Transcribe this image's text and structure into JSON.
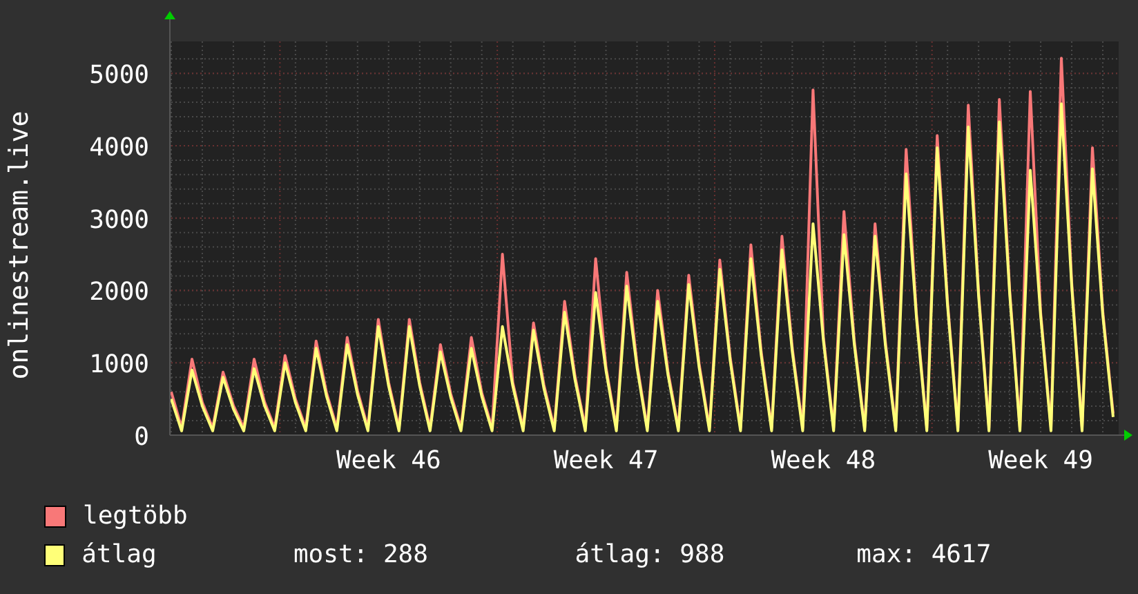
{
  "chart_data": {
    "type": "line",
    "ylabel": "onlinestream.live",
    "grid": true,
    "ylim": [
      0,
      5250
    ],
    "yticks": [
      0,
      1000,
      2000,
      3000,
      4000,
      5000
    ],
    "categories": [
      null,
      null,
      null,
      null,
      null,
      null,
      null,
      null,
      null,
      null,
      null,
      null,
      null,
      null,
      null,
      null,
      null,
      null,
      null,
      null,
      null,
      "Week 46",
      null,
      null,
      null,
      null,
      null,
      null,
      null,
      null,
      null,
      null,
      null,
      null,
      null,
      null,
      null,
      null,
      null,
      null,
      null,
      null,
      "Week 47",
      null,
      null,
      null,
      null,
      null,
      null,
      null,
      null,
      null,
      null,
      null,
      null,
      null,
      null,
      null,
      null,
      null,
      null,
      null,
      null,
      "Week 48",
      null,
      null,
      null,
      null,
      null,
      null,
      null,
      null,
      null,
      null,
      null,
      null,
      null,
      null,
      null,
      null,
      null,
      null,
      null,
      null,
      "Week 49",
      null,
      null,
      null,
      null,
      null,
      null,
      null
    ],
    "series": [
      {
        "name": "legtöbb",
        "color": "#f87878",
        "values": [
          600,
          100,
          1050,
          450,
          100,
          870,
          410,
          100,
          1050,
          460,
          100,
          1100,
          500,
          100,
          1300,
          590,
          100,
          1350,
          610,
          100,
          1600,
          730,
          100,
          1600,
          730,
          100,
          1250,
          570,
          100,
          1350,
          590,
          100,
          2500,
          730,
          100,
          1550,
          700,
          100,
          1850,
          820,
          100,
          2440,
          940,
          100,
          2250,
          980,
          100,
          2000,
          880,
          100,
          2210,
          990,
          100,
          2420,
          1080,
          100,
          2630,
          1150,
          100,
          2750,
          1200,
          100,
          4770,
          1360,
          100,
          3090,
          1300,
          100,
          2920,
          1290,
          100,
          3950,
          1670,
          100,
          4140,
          1840,
          100,
          4560,
          1970,
          100,
          4640,
          2000,
          100,
          4750,
          1700,
          100,
          5210,
          2110,
          100,
          3970,
          1710,
          300
        ]
      },
      {
        "name": "átlag",
        "color": "#ffff78",
        "values": [
          500,
          60,
          900,
          400,
          60,
          800,
          360,
          60,
          920,
          410,
          60,
          1000,
          450,
          60,
          1200,
          540,
          60,
          1250,
          560,
          60,
          1500,
          680,
          60,
          1500,
          680,
          60,
          1150,
          520,
          60,
          1200,
          540,
          60,
          1500,
          680,
          60,
          1450,
          650,
          60,
          1700,
          770,
          60,
          1970,
          890,
          60,
          2060,
          930,
          60,
          1850,
          830,
          60,
          2080,
          940,
          60,
          2290,
          1030,
          60,
          2440,
          1100,
          60,
          2560,
          1150,
          60,
          2920,
          1310,
          60,
          2770,
          1250,
          60,
          2750,
          1240,
          60,
          3610,
          1620,
          60,
          3970,
          1790,
          60,
          4260,
          1920,
          60,
          4330,
          1950,
          60,
          3660,
          1650,
          60,
          4580,
          2060,
          60,
          3680,
          1660,
          250
        ]
      }
    ]
  },
  "legend": {
    "stats": [
      "most: 288",
      "átlag: 988",
      "max: 4617"
    ]
  }
}
